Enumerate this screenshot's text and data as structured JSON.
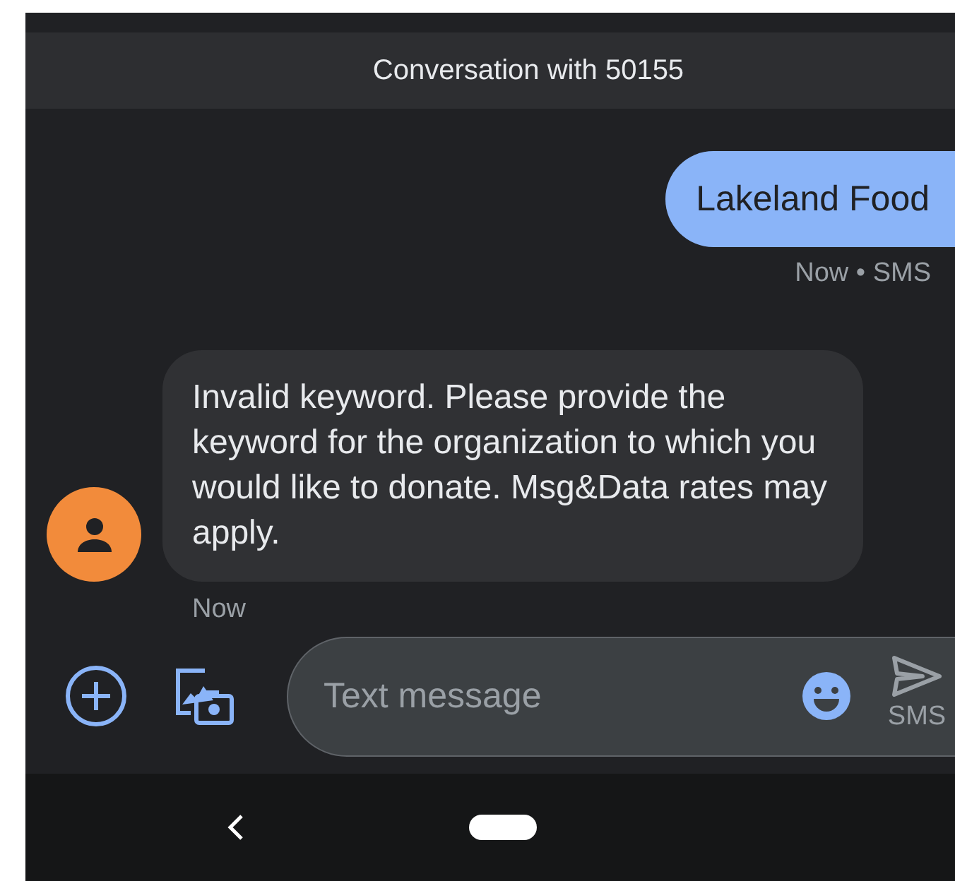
{
  "header": {
    "title": "Conversation with 50155"
  },
  "messages": [
    {
      "kind": "sent",
      "text": "Lakeland Food",
      "meta": "Now • SMS"
    },
    {
      "kind": "received",
      "text": "Invalid keyword. Please provide the keyword for the organization to which you would like to donate. Msg&Data rates may apply.",
      "meta": "Now"
    }
  ],
  "composer": {
    "placeholder": "Text message",
    "send_label": "SMS"
  }
}
